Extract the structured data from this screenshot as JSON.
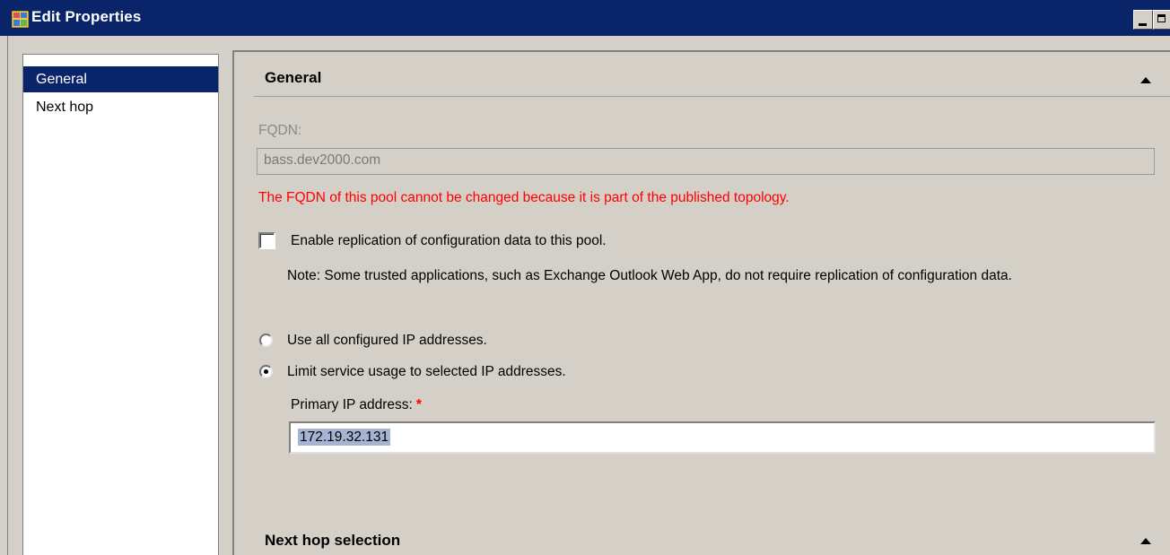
{
  "window": {
    "title": "Edit Properties"
  },
  "nav": {
    "items": [
      {
        "label": "General",
        "selected": true
      },
      {
        "label": "Next hop",
        "selected": false
      }
    ]
  },
  "general": {
    "header": "General",
    "fqdn_label": "FQDN:",
    "fqdn_value": "bass.dev2000.com",
    "fqdn_warning": "The FQDN of this pool cannot be changed because it is part of the published topology.",
    "replication_label": "Enable replication of configuration data to this pool.",
    "replication_checked": false,
    "note": "Note: Some trusted applications, such as Exchange Outlook Web App, do not require replication of configuration data.",
    "use_all_ip_label": "Use all configured IP addresses.",
    "limit_ip_label": "Limit service usage to selected IP addresses.",
    "selected_ip_option": "limit",
    "primary_ip_label": "Primary IP address:",
    "required_marker": "*",
    "primary_ip_value": "172.19.32.131"
  },
  "next_hop": {
    "header": "Next hop selection"
  },
  "colors": {
    "title_bar": "#0a246a",
    "warning": "#ff0000",
    "selection": "#0a246a"
  }
}
